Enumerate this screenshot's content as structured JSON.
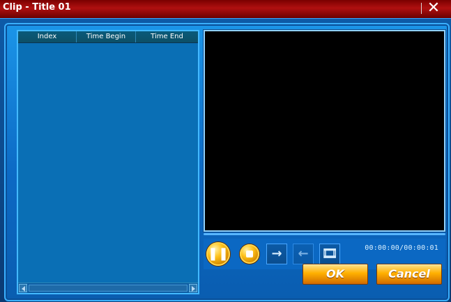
{
  "window": {
    "title": "Clip - Title 01",
    "close_glyph": "✕"
  },
  "table": {
    "columns": [
      "Index",
      "Time Begin",
      "Time End"
    ],
    "rows": []
  },
  "player": {
    "timecode": "00:00:00/00:00:01",
    "controls": [
      {
        "name": "pause-button",
        "icon": "pause-icon",
        "enabled": true
      },
      {
        "name": "stop-button",
        "icon": "stop-icon",
        "enabled": true
      },
      {
        "name": "set-begin-button",
        "icon": "arrow-right-icon",
        "enabled": true
      },
      {
        "name": "set-end-button",
        "icon": "arrow-left-icon",
        "enabled": false
      },
      {
        "name": "film-button",
        "icon": "film-icon",
        "enabled": true
      }
    ]
  },
  "actions": {
    "ok_label": "OK",
    "cancel_label": "Cancel"
  },
  "colors": {
    "titlebar": "#b01010",
    "panel": "#0c69c4",
    "accent": "#3ab0ff",
    "button_gold": "#ffb000"
  }
}
